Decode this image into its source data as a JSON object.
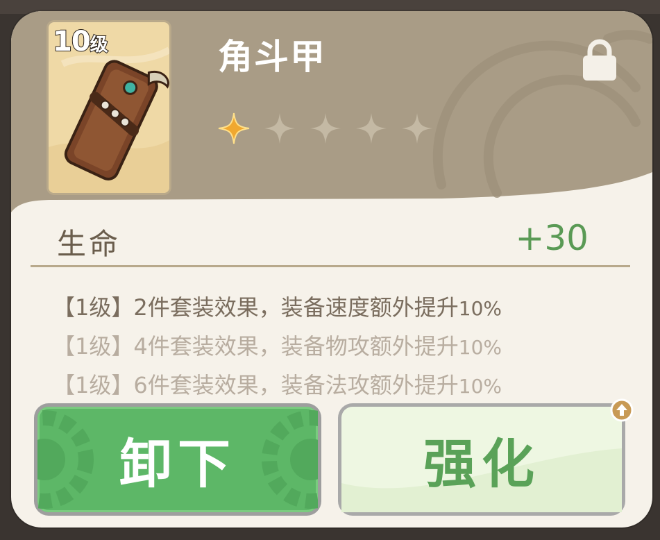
{
  "item": {
    "level_number": "10",
    "level_unit": "级",
    "name": "角斗甲",
    "stars_filled": 1,
    "stars_total": 5,
    "locked": true,
    "icon": "leather-armor-icon"
  },
  "stat": {
    "label": "生命",
    "value": "+30"
  },
  "set_effects": [
    {
      "tier": "【1级】",
      "text": "2件套装效果，装备速度额外提升",
      "pct": "10%",
      "active": true
    },
    {
      "tier": "【1级】",
      "text": "4件套装效果，装备物攻额外提升",
      "pct": "10%",
      "active": false
    },
    {
      "tier": "【1级】",
      "text": "6件套装效果，装备法攻额外提升",
      "pct": "10%",
      "active": false
    }
  ],
  "buttons": {
    "unequip": "卸下",
    "enhance": "强化"
  },
  "colors": {
    "header": "#a99c86",
    "star_active": "#f0a830",
    "star_inactive": "#c4b9a4",
    "accent_green": "#5db767",
    "stat_value": "#5a9a55"
  }
}
